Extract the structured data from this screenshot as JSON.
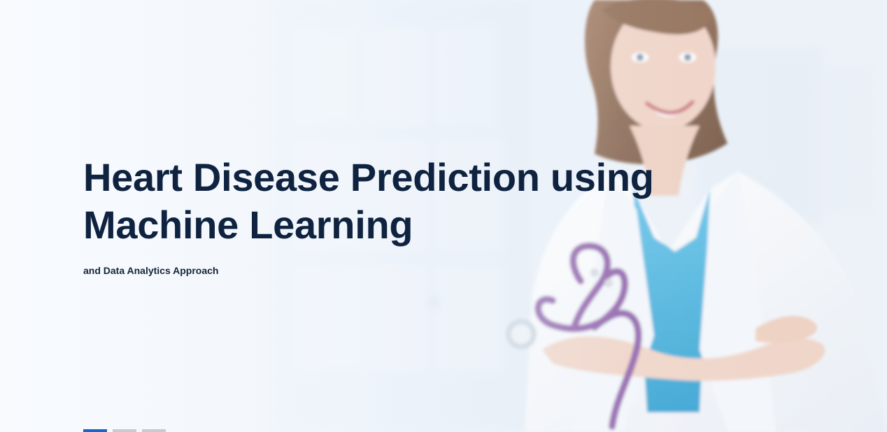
{
  "hero": {
    "title": "Heart Disease Prediction using Machine Learning",
    "subtitle": "and Data Analytics Approach"
  },
  "pagination": {
    "active_index": 0,
    "slides": 3
  },
  "colors": {
    "title": "#0f2340",
    "active_pager": "#1667c9",
    "inactive_pager": "#c8ccd1"
  }
}
